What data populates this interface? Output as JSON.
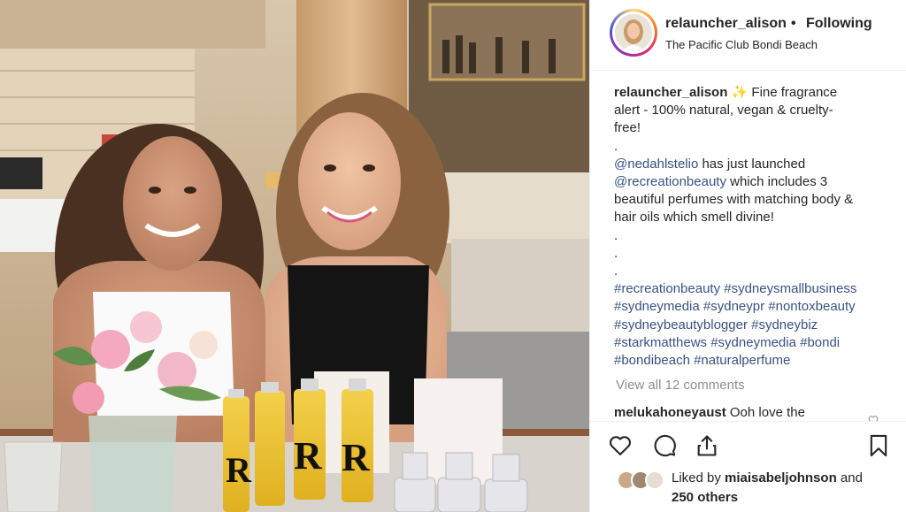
{
  "post": {
    "username": "relauncher_alison",
    "separator": "•",
    "follow_status": "Following",
    "location": "The Pacific Club Bondi Beach",
    "photo_icon": "photo-two-women-with-perfume-bottles"
  },
  "caption": {
    "username": "relauncher_alison",
    "sparkle": "✨",
    "line1_text": "Fine fragrance",
    "line2": "alert - 100% natural, vegan & cruelty-",
    "line3": "free!",
    "line4": ".",
    "mention1": "@nedahlstelio",
    "line5_text": " has just launched",
    "mention2": "@recreationbeauty",
    "line6_text": " which includes 3",
    "line7": "beautiful perfumes with matching body &",
    "line8": "hair oils which smell divine!",
    "line9": ".",
    "line10": ".",
    "line11": ".",
    "hashtags_line1": "#recreationbeauty #sydneysmallbusiness",
    "hashtags_line2": "#sydneymedia #sydneypr #nontoxbeauty",
    "hashtags_line3": "#sydneybeautyblogger #sydneybiz",
    "hashtags_line4": "#starkmatthews #sydneymedia #bondi",
    "hashtags_line5": "#bondibeach #naturalperfume"
  },
  "comments": {
    "view_all": "View all 12 comments",
    "first_user": "melukahoneyaust",
    "first_text": " Ooh love the"
  },
  "actions": {
    "like_icon": "heart-icon",
    "comment_icon": "comment-icon",
    "share_icon": "share-icon",
    "save_icon": "bookmark-icon"
  },
  "likes": {
    "prefix": "Liked by ",
    "user": "miaisabeljohnson",
    "middle": " and",
    "others": "250 others"
  },
  "colors": {
    "link": "#385185",
    "text": "#262626",
    "muted": "#8e8e8e"
  }
}
